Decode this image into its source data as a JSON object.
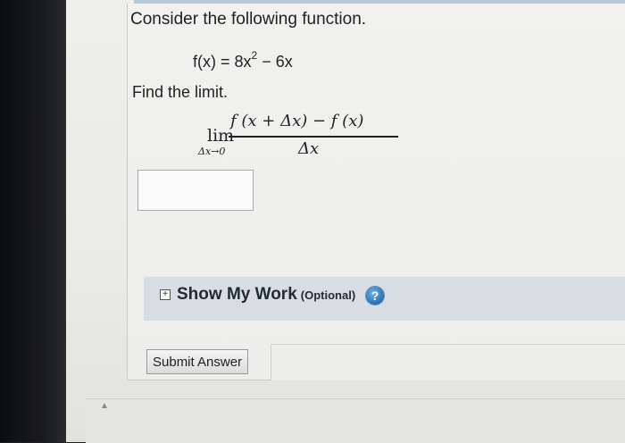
{
  "question": {
    "prompt": "Consider the following function.",
    "function_lhs": "f(x) = 8x",
    "function_exp": "2",
    "function_rhs": " − 6x",
    "instruction": "Find the limit."
  },
  "limit_expr": {
    "lim": "lim",
    "subscript": "Δx→0",
    "numerator": "f (x + Δx) − f (x)",
    "denominator": "Δx"
  },
  "answer_input": {
    "value": ""
  },
  "show_work": {
    "toggle": "+",
    "label": "Show My Work",
    "optional": "(Optional)",
    "help": "?"
  },
  "submit": {
    "label": "Submit Answer"
  },
  "icons": {
    "expand": "plus-box-icon",
    "help": "help-icon"
  }
}
